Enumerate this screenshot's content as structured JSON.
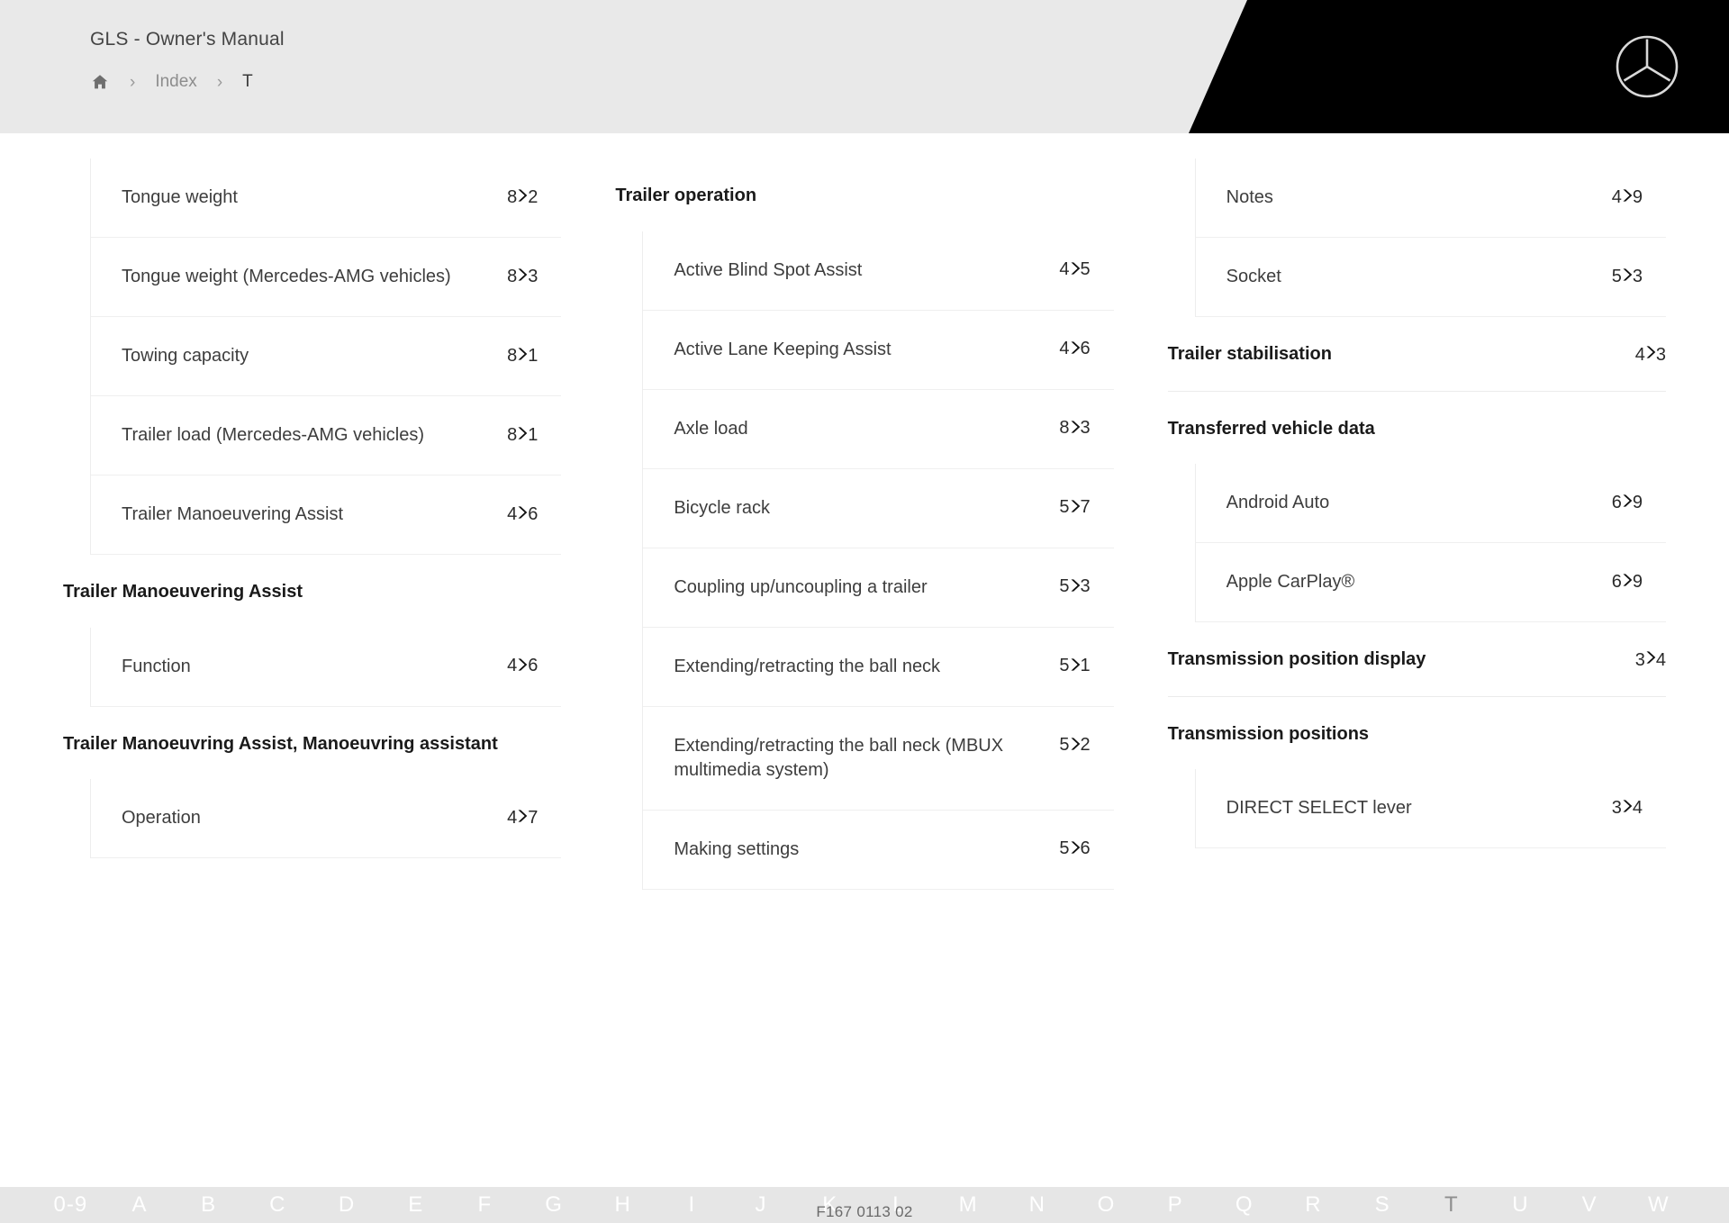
{
  "header": {
    "doc_title": "GLS - Owner's Manual",
    "breadcrumb": {
      "home_icon": "home-icon",
      "separator": "›",
      "index_label": "Index",
      "current_label": "T"
    },
    "brand_logo": "mercedes-benz-star-logo",
    "colors": {
      "header_bg": "#e9e9e9",
      "accent_black": "#000000"
    }
  },
  "columns": [
    {
      "blocks": [
        {
          "type": "entries",
          "items": [
            {
              "label": "Tongue weight",
              "chapter": "8",
              "page": "2"
            },
            {
              "label": "Tongue weight (Mercedes-AMG vehicles)",
              "chapter": "8",
              "page": "3"
            },
            {
              "label": "Towing capacity",
              "chapter": "8",
              "page": "1"
            },
            {
              "label": "Trailer load (Mercedes-AMG vehicles)",
              "chapter": "8",
              "page": "1"
            },
            {
              "label": "Trailer Manoeuvering Assist",
              "chapter": "4",
              "page": "6"
            }
          ]
        },
        {
          "type": "heading",
          "label": "Trailer Manoeuvering Assist",
          "chapter": "",
          "page": ""
        },
        {
          "type": "entries",
          "items": [
            {
              "label": "Function",
              "chapter": "4",
              "page": "6"
            }
          ]
        },
        {
          "type": "heading",
          "label": "Trailer Manoeuvring Assist, Manoeuvring assistant",
          "chapter": "",
          "page": ""
        },
        {
          "type": "entries",
          "items": [
            {
              "label": "Operation",
              "chapter": "4",
              "page": "7"
            }
          ]
        }
      ]
    },
    {
      "blocks": [
        {
          "type": "heading",
          "label": "Trailer operation",
          "chapter": "",
          "page": ""
        },
        {
          "type": "entries",
          "items": [
            {
              "label": "Active Blind Spot Assist",
              "chapter": "4",
              "page": "5"
            },
            {
              "label": "Active Lane Keeping Assist",
              "chapter": "4",
              "page": "6"
            },
            {
              "label": "Axle load",
              "chapter": "8",
              "page": "3"
            },
            {
              "label": "Bicycle rack",
              "chapter": "5",
              "page": "7"
            },
            {
              "label": "Coupling up/uncoupling a trailer",
              "chapter": "5",
              "page": "3"
            },
            {
              "label": "Extending/retracting the ball neck",
              "chapter": "5",
              "page": "1"
            },
            {
              "label": "Extending/retracting the ball neck (MBUX multimedia system)",
              "chapter": "5",
              "page": "2"
            },
            {
              "label": "Making settings",
              "chapter": "5",
              "page": "6"
            }
          ]
        }
      ]
    },
    {
      "blocks": [
        {
          "type": "entries",
          "items": [
            {
              "label": "Notes",
              "chapter": "4",
              "page": "9"
            },
            {
              "label": "Socket",
              "chapter": "5",
              "page": "3"
            }
          ]
        },
        {
          "type": "heading",
          "label": "Trailer stabilisation",
          "chapter": "4",
          "page": "3"
        },
        {
          "type": "heading",
          "label": "Transferred vehicle data",
          "chapter": "",
          "page": ""
        },
        {
          "type": "entries",
          "items": [
            {
              "label": "Android Auto",
              "chapter": "6",
              "page": "9"
            },
            {
              "label": "Apple CarPlay®",
              "chapter": "6",
              "page": "9"
            }
          ]
        },
        {
          "type": "heading",
          "label": "Transmission position display",
          "chapter": "3",
          "page": "4"
        },
        {
          "type": "heading",
          "label": "Transmission positions",
          "chapter": "",
          "page": ""
        },
        {
          "type": "entries",
          "items": [
            {
              "label": "DIRECT SELECT lever",
              "chapter": "3",
              "page": "4"
            }
          ]
        }
      ]
    }
  ],
  "alpha_nav": {
    "letters": [
      "0-9",
      "A",
      "B",
      "C",
      "D",
      "E",
      "F",
      "G",
      "H",
      "I",
      "J",
      "K",
      "L",
      "M",
      "N",
      "O",
      "P",
      "Q",
      "R",
      "S",
      "T",
      "U",
      "V",
      "W"
    ],
    "active": "T"
  },
  "footer": {
    "code": "F167 0113 02"
  }
}
